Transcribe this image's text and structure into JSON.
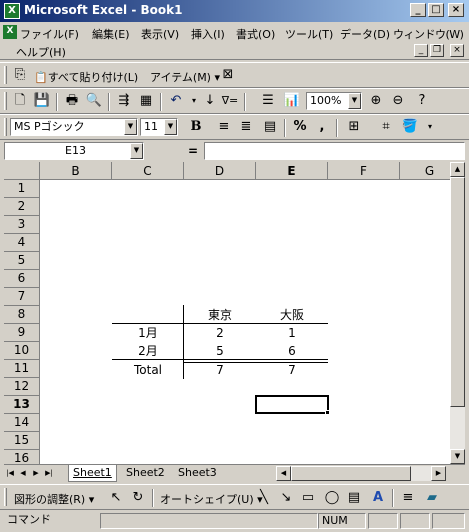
{
  "window": {
    "title": "Microsoft Excel - Book1",
    "app_icon": "X"
  },
  "menu": {
    "items": [
      "ファイル(F)",
      "編集(E)",
      "表示(V)",
      "挿入(I)",
      "書式(O)",
      "ツール(T)",
      "データ(D)",
      "ウィンドウ(W)",
      "ヘルプ(H)"
    ]
  },
  "paste_toolbar": {
    "paste_all": "すべて貼り付け(L)",
    "items": "アイテム(M)"
  },
  "standard_toolbar": {
    "zoom": "100%"
  },
  "format_toolbar": {
    "font": "MS Pゴシック",
    "size": "11",
    "bold": "B",
    "percent": "%",
    "comma": ","
  },
  "formula_bar": {
    "name_box": "E13",
    "equals": "="
  },
  "columns": [
    "B",
    "C",
    "D",
    "E",
    "F",
    "G"
  ],
  "rows": [
    "1",
    "2",
    "3",
    "4",
    "5",
    "6",
    "7",
    "8",
    "9",
    "10",
    "11",
    "12",
    "13",
    "14",
    "15",
    "16"
  ],
  "table": {
    "header": [
      "東京",
      "大阪"
    ],
    "rows": [
      {
        "label": "1月",
        "values": [
          "2",
          "1"
        ]
      },
      {
        "label": "2月",
        "values": [
          "5",
          "6"
        ]
      },
      {
        "label": "Total",
        "values": [
          "7",
          "7"
        ]
      }
    ]
  },
  "sheet_tabs": [
    "Sheet1",
    "Sheet2",
    "Sheet3"
  ],
  "drawing_toolbar": {
    "draw": "図形の調整(R)",
    "autoshapes": "オートシェイプ(U)"
  },
  "status": {
    "mode": "コマンド",
    "num": "NUM"
  }
}
